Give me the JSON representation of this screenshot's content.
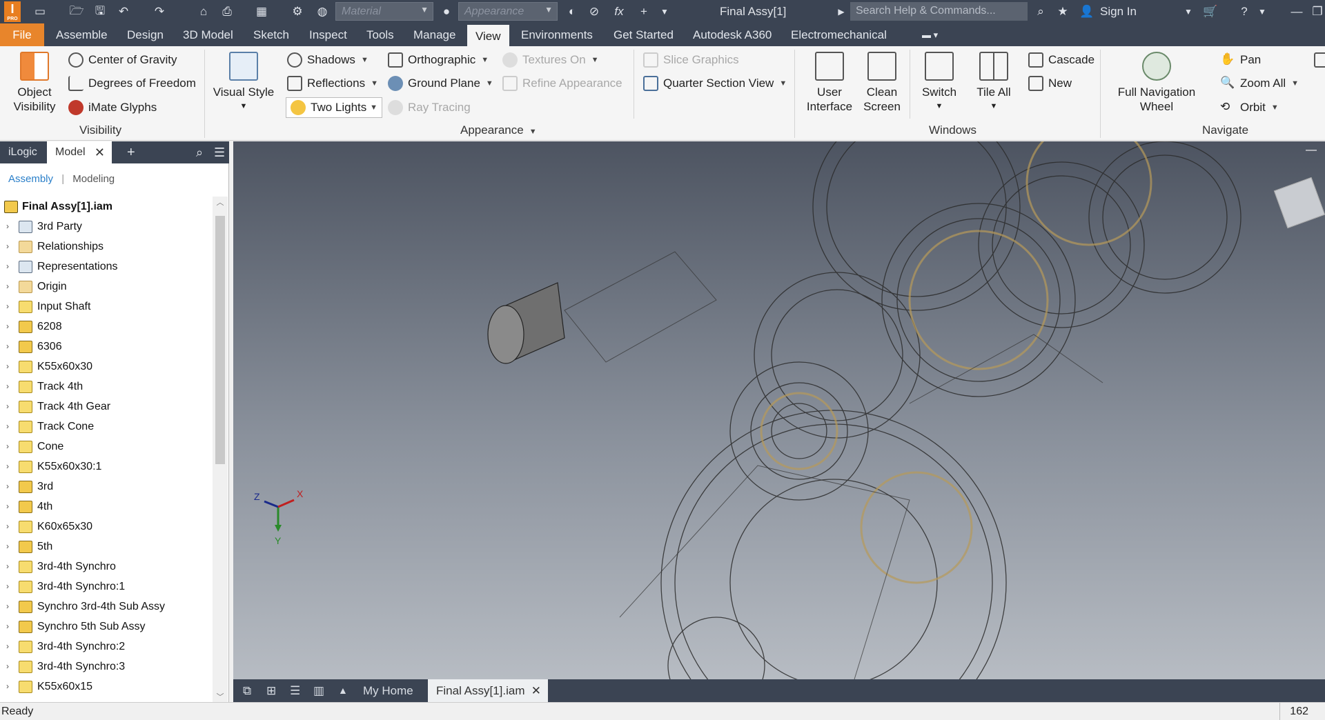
{
  "window": {
    "title": "Final Assy[1]",
    "logo_text": "I",
    "logo_sub": "PRO"
  },
  "quick_access": {
    "material_placeholder": "Material",
    "appearance_placeholder": "Appearance",
    "fx_label": "fx"
  },
  "search": {
    "placeholder": "Search Help & Commands..."
  },
  "account": {
    "sign_in": "Sign In"
  },
  "menu": {
    "items": [
      "File",
      "Assemble",
      "Design",
      "3D Model",
      "Sketch",
      "Inspect",
      "Tools",
      "Manage",
      "View",
      "Environments",
      "Get Started",
      "Autodesk A360",
      "Electromechanical"
    ],
    "active": "View"
  },
  "ribbon": {
    "visibility": {
      "object_visibility": [
        "Object",
        "Visibility"
      ],
      "center_of_gravity": "Center of Gravity",
      "degrees_of_freedom": "Degrees of Freedom",
      "imate_glyphs": "iMate Glyphs",
      "group": "Visibility"
    },
    "appearance": {
      "visual_style": "Visual Style",
      "shadows": "Shadows",
      "reflections": "Reflections",
      "two_lights": "Two Lights",
      "orthographic": "Orthographic",
      "ground_plane": "Ground Plane",
      "ray_tracing": "Ray Tracing",
      "textures_on": "Textures On",
      "refine_appearance": "Refine Appearance",
      "slice_graphics": "Slice Graphics",
      "quarter_section_view": "Quarter Section View",
      "group": "Appearance"
    },
    "windows": {
      "user_interface": [
        "User",
        "Interface"
      ],
      "clean_screen": [
        "Clean",
        "Screen"
      ],
      "switch": "Switch",
      "tile_all": "Tile All",
      "cascade": "Cascade",
      "new": "New",
      "group": "Windows"
    },
    "navigate": {
      "full_nav_wheel": [
        "Full Navigation",
        "Wheel"
      ],
      "pan": "Pan",
      "zoom_all": "Zoom All",
      "orbit": "Orbit",
      "group": "Navigate"
    }
  },
  "panel": {
    "tabs": [
      "iLogic",
      "Model"
    ],
    "subtabs": [
      "Assembly",
      "Modeling"
    ],
    "root": "Final Assy[1].iam",
    "items": [
      {
        "label": "3rd Party",
        "icon": "spc"
      },
      {
        "label": "Relationships",
        "icon": "fld"
      },
      {
        "label": "Representations",
        "icon": "spc"
      },
      {
        "label": "Origin",
        "icon": "fld"
      },
      {
        "label": "Input Shaft",
        "icon": "prt"
      },
      {
        "label": "6208",
        "icon": "asm"
      },
      {
        "label": "6306",
        "icon": "asm"
      },
      {
        "label": "K55x60x30",
        "icon": "prt"
      },
      {
        "label": "Track 4th",
        "icon": "prt"
      },
      {
        "label": "Track 4th Gear",
        "icon": "prt"
      },
      {
        "label": "Track Cone",
        "icon": "prt"
      },
      {
        "label": "Cone",
        "icon": "prt"
      },
      {
        "label": "K55x60x30:1",
        "icon": "prt"
      },
      {
        "label": "3rd",
        "icon": "asm"
      },
      {
        "label": "4th",
        "icon": "asm"
      },
      {
        "label": "K60x65x30",
        "icon": "prt"
      },
      {
        "label": "5th",
        "icon": "asm"
      },
      {
        "label": "3rd-4th Synchro",
        "icon": "prt"
      },
      {
        "label": "3rd-4th Synchro:1",
        "icon": "prt"
      },
      {
        "label": "Synchro 3rd-4th Sub Assy",
        "icon": "asm"
      },
      {
        "label": "Synchro 5th Sub Assy",
        "icon": "asm"
      },
      {
        "label": "3rd-4th Synchro:2",
        "icon": "prt"
      },
      {
        "label": "3rd-4th Synchro:3",
        "icon": "prt"
      },
      {
        "label": "K55x60x15",
        "icon": "prt"
      }
    ]
  },
  "triad": {
    "x": "X",
    "y": "Y",
    "z": "Z"
  },
  "bottom_tabs": {
    "home": "My Home",
    "doc": "Final Assy[1].iam"
  },
  "status": {
    "text": "Ready",
    "count": "162"
  }
}
